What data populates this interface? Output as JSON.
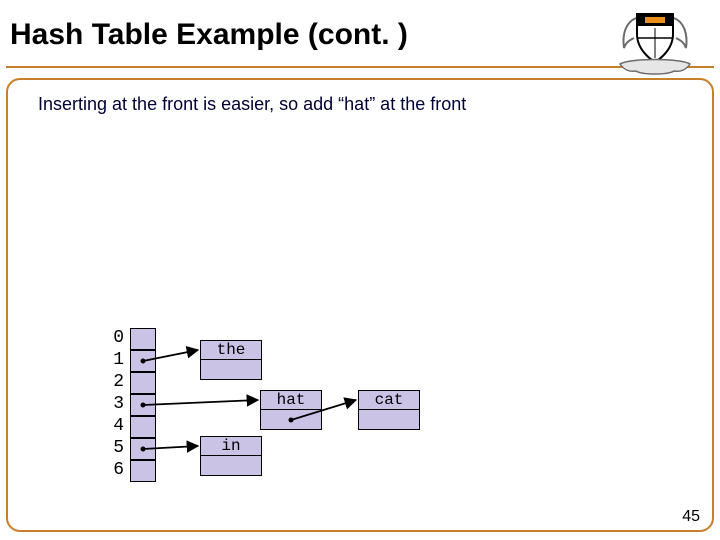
{
  "title": "Hash Table Example (cont. )",
  "body_text": "Inserting at the front is easier, so add “hat” at the front",
  "page_number": "45",
  "buckets": {
    "i0": "0",
    "i1": "1",
    "i2": "2",
    "i3": "3",
    "i4": "4",
    "i5": "5",
    "i6": "6"
  },
  "nodes": {
    "the": "the",
    "hat": "hat",
    "cat": "cat",
    "inw": "in"
  },
  "logo": {
    "alt": "princeton-shield"
  }
}
